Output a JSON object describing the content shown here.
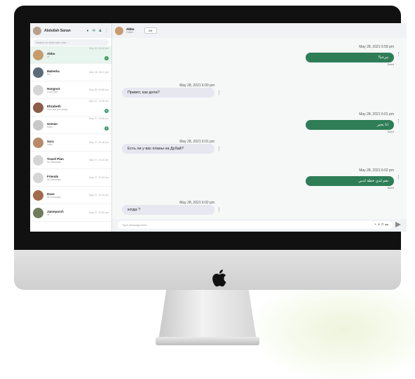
{
  "sidebar": {
    "user_name": "Abdullah Sanan",
    "search_placeholder": "Search or start new chat",
    "contacts": [
      {
        "name": "Abbo",
        "preview": "Hi",
        "time": "May 28, 05:52 pm",
        "badge": "1",
        "avatar_color": "#c79b6c"
      },
      {
        "name": "Maleeha",
        "preview": "Hi:)",
        "time": "May 28, 06:11 pm",
        "badge": "",
        "avatar_color": "#5a6b7a"
      },
      {
        "name": "Hangout",
        "preview": "Good Bye",
        "time": "May 28, 05:58 pm",
        "badge": "",
        "avatar_color": "#d5d5d5"
      },
      {
        "name": "Elizabeth",
        "preview": "How are you doing",
        "time": "May 27, 11:56 am",
        "badge": "5",
        "avatar_color": "#8b5e4a"
      },
      {
        "name": "Usman",
        "preview": "Hello",
        "time": "May 27, 10:58 pm",
        "badge": "3",
        "avatar_color": "#c8c8c8"
      },
      {
        "name": "Sara",
        "preview": "Hello",
        "time": "May 27, 09:15 pm",
        "badge": "",
        "avatar_color": "#b88a6a"
      },
      {
        "name": "Travel Plan",
        "preview": "No Message",
        "time": "May 27, 10:32 am",
        "badge": "",
        "avatar_color": "#d5d5d5"
      },
      {
        "name": "Friends",
        "preview": "No Message",
        "time": "May 27, 10:33 am",
        "badge": "",
        "avatar_color": "#d5d5d5"
      },
      {
        "name": "Dave",
        "preview": "No message",
        "time": "May 27, 10:34 am",
        "badge": "",
        "avatar_color": "#a26b4b"
      },
      {
        "name": "Jameparch",
        "preview": "Hi",
        "time": "May 27, 10:00 am",
        "badge": "",
        "avatar_color": "#6f7d5a"
      }
    ]
  },
  "chat": {
    "contact_name": "Abbo",
    "contact_status": "Online",
    "language_select": "All",
    "messages": [
      {
        "dir": "out",
        "time": "May 28, 2021 5:59 pm",
        "text": "مرحبا!",
        "seen": "Seen"
      },
      {
        "dir": "in",
        "time": "May 28, 2021 6:00 pm",
        "text": "Привет, как дела?"
      },
      {
        "dir": "out",
        "time": "May 28, 2021 6:01 pm",
        "text": "انا بخير",
        "seen": "Seen"
      },
      {
        "dir": "in",
        "time": "May 28, 2021 6:01 pm",
        "text": "Есть ли у вас планы на Дубай?"
      },
      {
        "dir": "out",
        "time": "May 28, 2021 6:02 pm",
        "text": "نعم لدي خطة لدبي",
        "seen": "Seen"
      },
      {
        "dir": "in",
        "time": "May 28, 2021 6:02 pm",
        "text": "когда ?"
      }
    ],
    "composer_placeholder": "Type message here..."
  },
  "colors": {
    "accent": "#2e7d57",
    "bubble_in": "#e6e7ef",
    "bezel": "#111111"
  }
}
